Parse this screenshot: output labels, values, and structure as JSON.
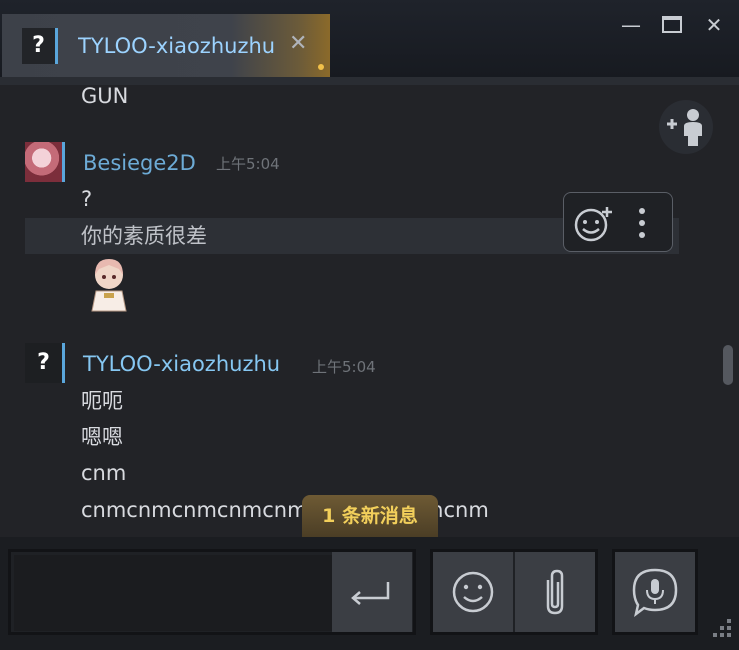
{
  "tab": {
    "avatar_text": "?",
    "title": "TYLOO-xiaozhuzhu",
    "close_glyph": "✕"
  },
  "window_controls": {
    "minimize": "—",
    "maximize": "☐",
    "close": "✕"
  },
  "messages": {
    "partial_line": "GUN",
    "group1": {
      "sender": "Besiege2D",
      "time": "上午5:04",
      "lines": [
        "?",
        "你的素质很差"
      ]
    },
    "group2": {
      "avatar_text": "?",
      "sender": "TYLOO-xiaozhuzhu",
      "time": "上午5:04",
      "lines": [
        "呃呃",
        "嗯嗯",
        "cnm",
        "cnmcnmcnmcnmcnmcnmcnmcnmcnm"
      ]
    }
  },
  "new_messages_banner": "1 条新消息",
  "composer": {
    "placeholder": ""
  },
  "icons": {
    "invite": "add-friend-icon",
    "react": "add-reaction-icon",
    "more": "more-vertical-icon",
    "send": "enter-icon",
    "emoji": "smiley-icon",
    "attach": "paperclip-icon",
    "voice": "microphone-icon",
    "resize": "resize-grip-icon"
  },
  "colors": {
    "accent": "#5aa6db",
    "banner_text": "#f2cf5b",
    "name_besiege": "#6dabd6",
    "name_tyloo": "#86c7f2"
  }
}
